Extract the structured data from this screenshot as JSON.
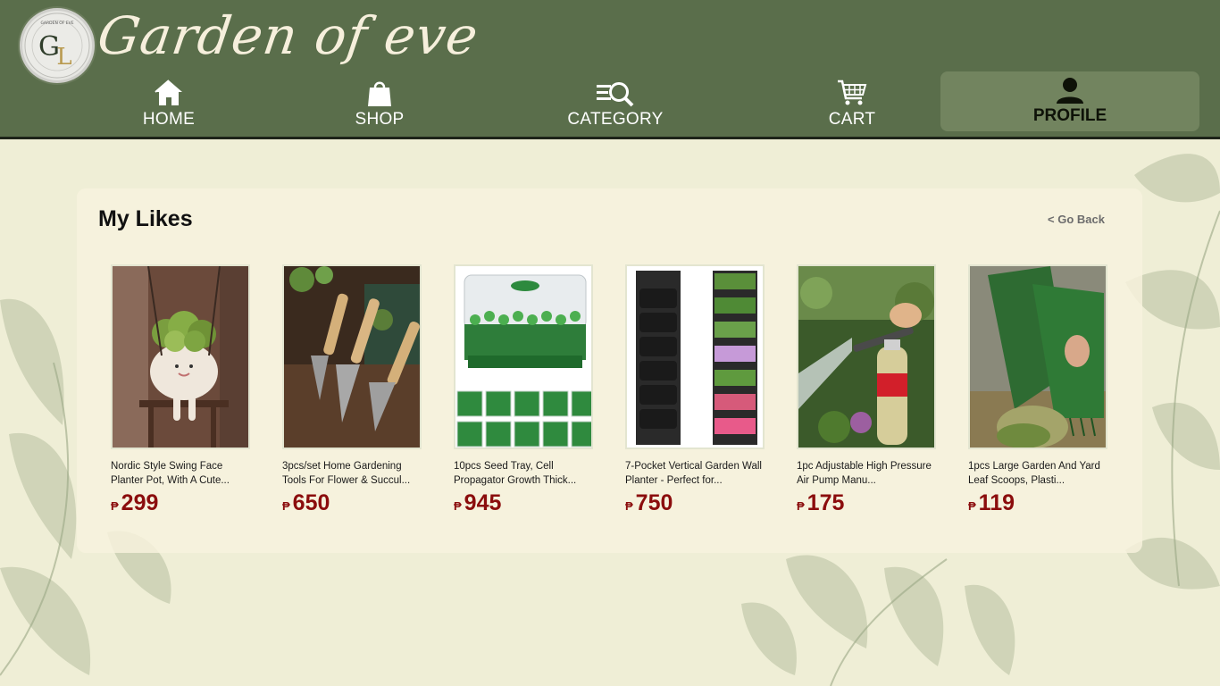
{
  "brand": {
    "name": "Garden of eve",
    "logo_monogram": "GL",
    "logo_ring_text": "GARDEN OF EVE"
  },
  "nav": {
    "home": "HOME",
    "shop": "SHOP",
    "category": "CATEGORY",
    "cart": "CART",
    "profile": "PROFILE"
  },
  "page": {
    "title": "My Likes",
    "go_back": "< Go Back"
  },
  "products": [
    {
      "name": "Nordic Style Swing Face Planter Pot, With A Cute...",
      "currency": "₱",
      "price": "299"
    },
    {
      "name": "3pcs/set Home Gardening Tools For Flower & Succul...",
      "currency": "₱",
      "price": "650"
    },
    {
      "name": "10pcs Seed Tray, Cell Propagator Growth Thick...",
      "currency": "₱",
      "price": "945"
    },
    {
      "name": "7-Pocket Vertical Garden Wall Planter - Perfect for...",
      "currency": "₱",
      "price": "750"
    },
    {
      "name": "1pc Adjustable High Pressure Air Pump Manu...",
      "currency": "₱",
      "price": "175"
    },
    {
      "name": "1pcs Large Garden And Yard Leaf Scoops, Plasti...",
      "currency": "₱",
      "price": "119"
    }
  ],
  "colors": {
    "header": "#5a6e4b",
    "background": "#efeed6",
    "price": "#8b0d0d",
    "profile_active": "#72845f"
  }
}
